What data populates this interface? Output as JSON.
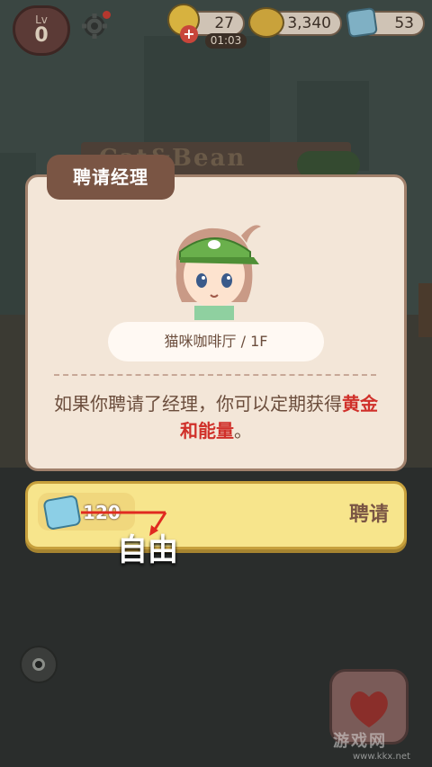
{
  "hud": {
    "level_label": "Lv",
    "level_value": "0",
    "energy_value": "27",
    "energy_timer": "01:03",
    "gold_value": "3,340",
    "gem_value": "53",
    "icons": [
      "heart-icon",
      "gear-icon",
      "energy-icon",
      "plus-icon",
      "gold-coin-icon",
      "gem-icon"
    ]
  },
  "background": {
    "sign_text": "Cat&Bean"
  },
  "dialog": {
    "title": "聘请经理",
    "location": "猫咪咖啡厅 / 1F",
    "description_prefix": "如果你聘请了经理，你可以定期获得",
    "description_highlight": "黄金和能量",
    "description_suffix": "。"
  },
  "hire": {
    "cost": "120",
    "button_label": "聘请",
    "free_label": "自由"
  },
  "watermark": {
    "text": "游戏网",
    "url": "www.kkx.net"
  },
  "colors": {
    "dialog_bg": "#f3e6d8",
    "title_bg": "#7a5544",
    "button_bg": "#f7e58c",
    "highlight": "#d0302a"
  }
}
